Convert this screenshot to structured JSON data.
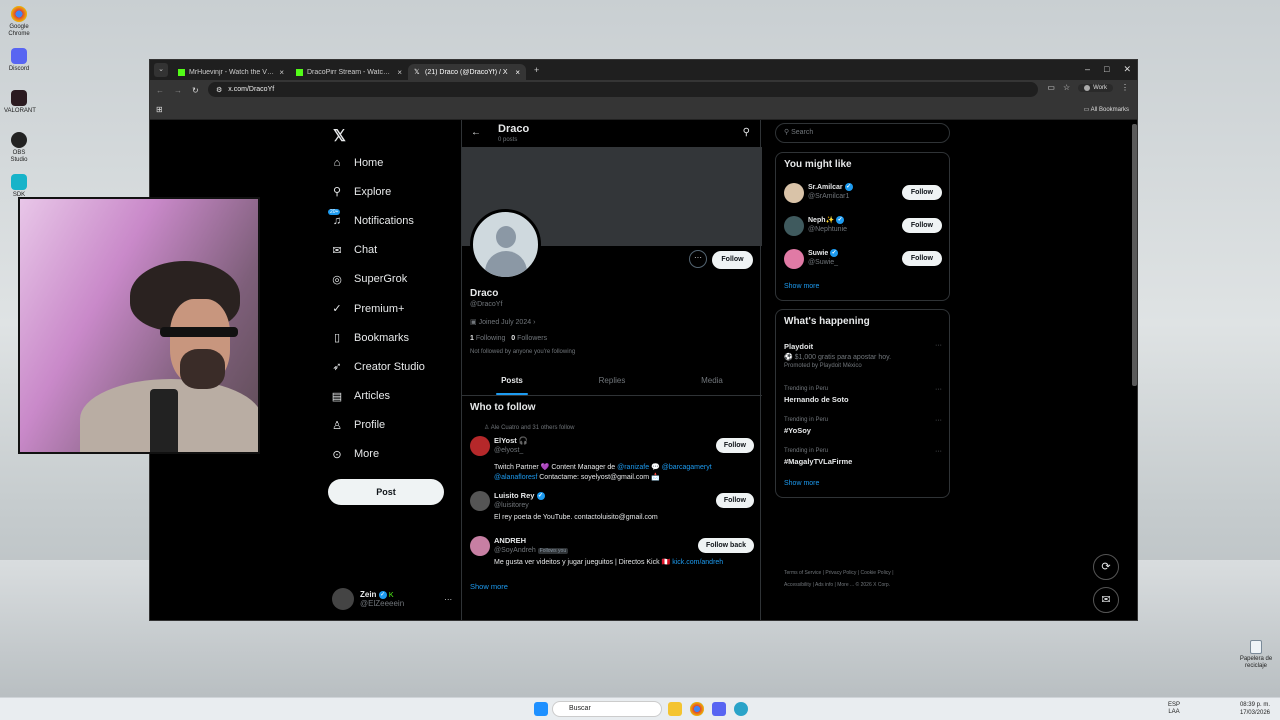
{
  "desktop": {
    "icons": [
      "Google Chrome",
      "Discord",
      "VALORANT",
      "OBS Studio",
      "SDK"
    ],
    "recycle_bin": "Papelera de reciclaje"
  },
  "browser": {
    "tabs": [
      {
        "label": "MrHuevinjr - Watch the VOD ...",
        "active": false
      },
      {
        "label": "DracoPirr Stream - Watch Li...",
        "active": false
      },
      {
        "label": "(21) Draco (@DracoYf) / X",
        "active": true
      }
    ],
    "url": "x.com/DracoYf",
    "profile_chip": "Work",
    "all_bookmarks": "All Bookmarks"
  },
  "x": {
    "nav": [
      {
        "label": "Home",
        "icon": "home-icon"
      },
      {
        "label": "Explore",
        "icon": "search-icon"
      },
      {
        "label": "Notifications",
        "icon": "bell-icon",
        "badge": "20+"
      },
      {
        "label": "Chat",
        "icon": "mail-icon"
      },
      {
        "label": "SuperGrok",
        "icon": "grok-icon"
      },
      {
        "label": "Premium+",
        "icon": "x-icon"
      },
      {
        "label": "Bookmarks",
        "icon": "bookmark-icon"
      },
      {
        "label": "Creator Studio",
        "icon": "rocket-icon"
      },
      {
        "label": "Articles",
        "icon": "article-icon"
      },
      {
        "label": "Profile",
        "icon": "person-icon"
      },
      {
        "label": "More",
        "icon": "more-icon"
      }
    ],
    "post_button": "Post",
    "account": {
      "name": "Zein",
      "handle": "@ElZeeeein"
    },
    "header": {
      "name": "Draco",
      "posts": "0 posts"
    },
    "profile": {
      "name": "Draco",
      "handle": "@DracoYf",
      "joined": "Joined July 2024",
      "following_count": "1",
      "following_label": "Following",
      "followers_count": "0",
      "followers_label": "Followers",
      "not_followed": "Not followed by anyone you're following",
      "follow_button": "Follow"
    },
    "tabs": [
      "Posts",
      "Replies",
      "Media"
    ],
    "who_to_follow": {
      "title": "Who to follow",
      "context": "Ale Cuatro and 31 others follow",
      "people": [
        {
          "name": "ElYost 🎧",
          "handle": "@elyost_",
          "bio_a": "Twitch Partner 💜 Content Manager de ",
          "link_a": "@ranizafe",
          "bio_b": " 💬 ",
          "link_b": "@barcagameryt",
          "link_c": "@alanafloresf",
          "bio_c": " Contactame: soyelyost@gmail.com 📩",
          "button": "Follow"
        },
        {
          "name": "Luisito Rey",
          "handle": "@luisitorey",
          "bio": "El rey poeta de YouTube. contactoluisito@gmail.com",
          "button": "Follow"
        },
        {
          "name": "ANDREH",
          "handle": "@SoyAndreh",
          "follows_you": "Follows you",
          "bio": "Me gusta ver videitos y jugar jueguitos | Directos Kick 🇵🇪 ",
          "link": "kick.com/andreh",
          "button": "Follow back"
        }
      ],
      "show_more": "Show more"
    },
    "search_placeholder": "Search",
    "you_might_like": {
      "title": "You might like",
      "people": [
        {
          "name": "Sr.Amilcar",
          "handle": "@SrAmilcar1",
          "button": "Follow"
        },
        {
          "name": "Neph✨",
          "handle": "@Nephtunie",
          "button": "Follow"
        },
        {
          "name": "Suwie",
          "handle": "@Suwie_",
          "button": "Follow"
        }
      ],
      "show_more": "Show more"
    },
    "whats_happening": {
      "title": "What's happening",
      "promo": {
        "name": "Playdoit",
        "text": "⚽ $1,000 gratis para apostar hoy.",
        "promoted": "Promoted by Playdoit México"
      },
      "trends": [
        {
          "context": "Trending in Peru",
          "name": "Hernando de Soto"
        },
        {
          "context": "Trending in Peru",
          "name": "#YoSoy"
        },
        {
          "context": "Trending in Peru",
          "name": "#MagalyTVLaFirme"
        }
      ],
      "show_more": "Show more"
    },
    "footer": [
      "Terms of Service",
      "Privacy Policy",
      "Cookie Policy",
      "Accessibility",
      "Ads info",
      "More ...",
      "© 2026 X Corp."
    ]
  },
  "taskbar": {
    "search": "Buscar",
    "lang": "ESP",
    "lang2": "LAA",
    "time": "08:39 p. m.",
    "date": "17/03/2026"
  },
  "colors": {
    "accent": "#1d9bf0",
    "bg": "#000000",
    "border": "#2f3336"
  }
}
